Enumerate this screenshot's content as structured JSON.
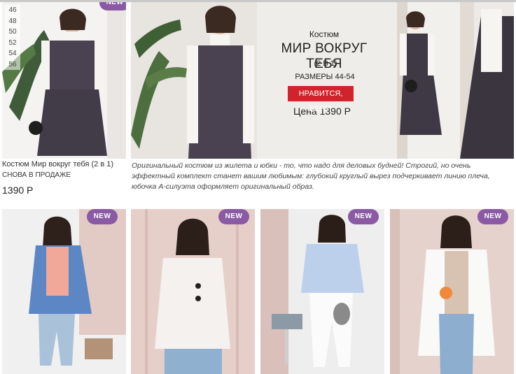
{
  "badge_new": "NEW",
  "sizes": [
    "46",
    "48",
    "50",
    "52",
    "54",
    "56"
  ],
  "product": {
    "name": "Костюм Мир вокруг тебя (2 в 1)",
    "status": "СНОВА В ПРОДАЖЕ",
    "price": "1390 Р"
  },
  "banner": {
    "kicker": "Костюм",
    "title": "МИР ВОКРУГ ТЕБЯ",
    "subtitle": "(2 В 1)",
    "sizes": "РАЗМЕРЫ 44-54",
    "button": "НРАВИТСЯ, БЕРУ!",
    "price": "Цена 1390 Р"
  },
  "description": "Оригинальный костюм из жилета и юбки - то, что надо для деловых будней! Строгий, но очень эффектный комплект станет вашим любимым: глубокий круглый вырез подчеркивает линию плеча, юбочка А-силуэта оформляет оригинальный образ.",
  "colors": {
    "badge": "#8b5aa5",
    "cta": "#d0232b",
    "wall_pink": "#e8cfc9",
    "wall_light": "#f1efef"
  }
}
